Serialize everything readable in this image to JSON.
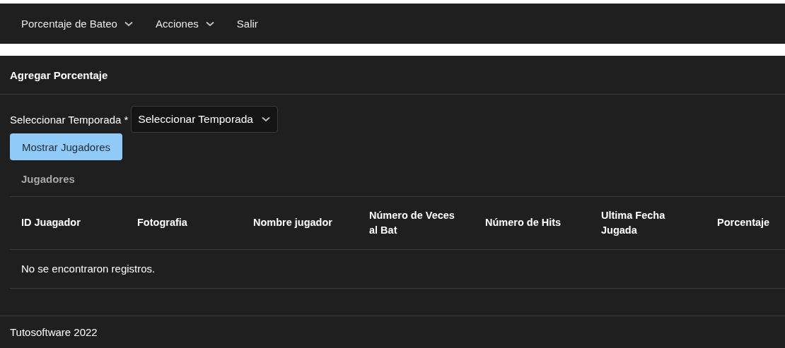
{
  "navbar": {
    "items": [
      {
        "label": "Porcentaje de Bateo",
        "kind": "dropdown"
      },
      {
        "label": "Acciones",
        "kind": "dropdown"
      },
      {
        "label": "Salir",
        "kind": "link"
      }
    ]
  },
  "card": {
    "title": "Agregar Porcentaje",
    "season_field": {
      "label": "Seleccionar Temporada",
      "required_mark": "*",
      "value": "Seleccionar Temporada"
    },
    "button": "Mostrar Jugadores",
    "table_caption": "Jugadores",
    "table": {
      "columns": [
        "ID Juagador",
        "Fotografia",
        "Nombre jugador",
        "Número de Veces al Bat",
        "Número de Hits",
        "Ultima Fecha Jugada",
        "Porcentaje"
      ],
      "empty_message": "No se encontraron registros."
    }
  },
  "footer": {
    "text": "Tutosoftware 2022"
  }
}
